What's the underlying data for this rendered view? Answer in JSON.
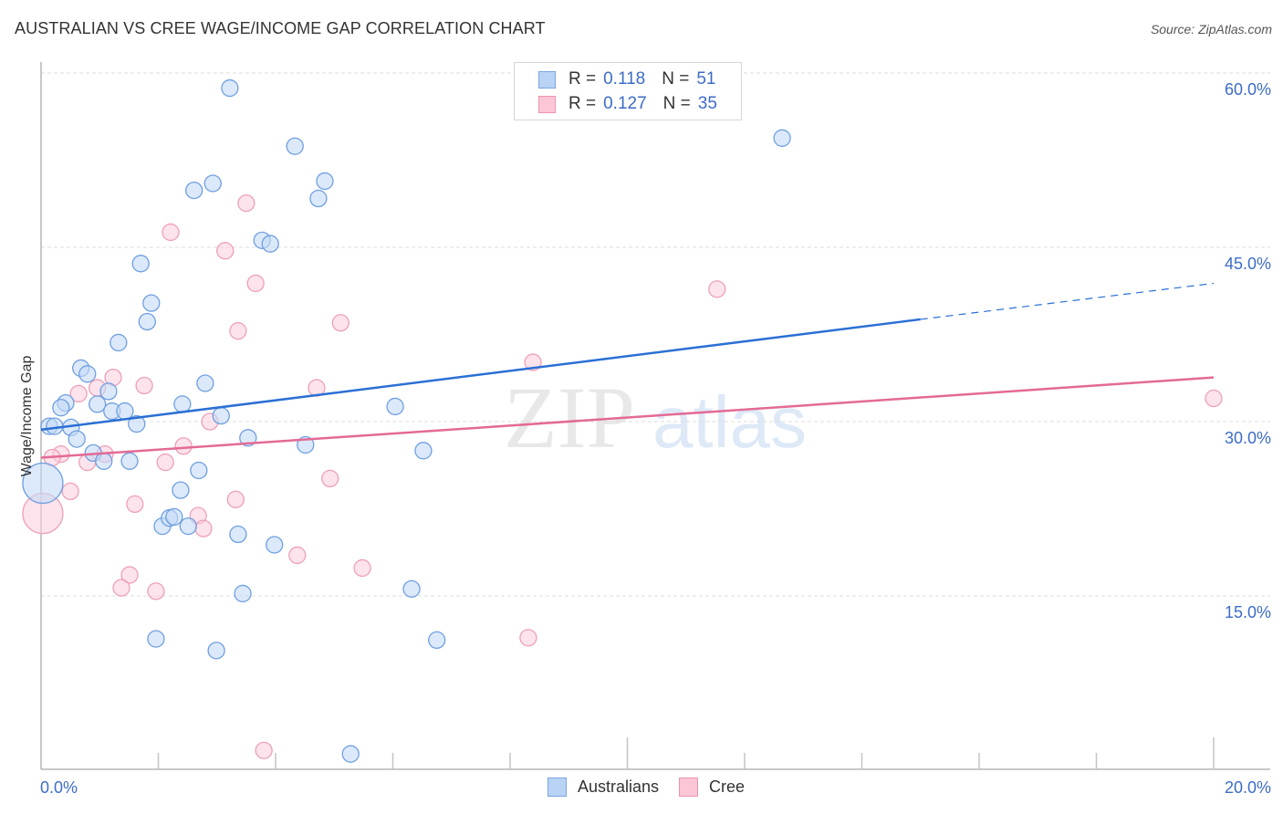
{
  "header": {
    "title": "AUSTRALIAN VS CREE WAGE/INCOME GAP CORRELATION CHART",
    "source": "Source: ZipAtlas.com"
  },
  "legend": {
    "rows": [
      {
        "r_label": "R =",
        "r_value": "0.118",
        "n_label": "N =",
        "n_value": "51",
        "swatch_fill": "#b9d3f5",
        "swatch_border": "#7aa6e0"
      },
      {
        "r_label": "R =",
        "r_value": "0.127",
        "n_label": "N =",
        "n_value": "35",
        "swatch_fill": "#fcc6d6",
        "swatch_border": "#ec94b0"
      }
    ]
  },
  "bottom_legend": [
    {
      "label": "Australians",
      "swatch_fill": "#b9d3f5",
      "swatch_border": "#7aa6e0"
    },
    {
      "label": "Cree",
      "swatch_fill": "#fcc6d6",
      "swatch_border": "#ec94b0"
    }
  ],
  "watermark": {
    "zip": "ZIP",
    "atlas": "atlas"
  },
  "chart_data": {
    "type": "scatter",
    "title": "AUSTRALIAN VS CREE WAGE/INCOME GAP CORRELATION CHART",
    "xlabel": "",
    "ylabel": "Wage/Income Gap",
    "xlim": [
      0,
      20
    ],
    "ylim": [
      0,
      62
    ],
    "x_tick_labels": [
      "0.0%",
      "20.0%"
    ],
    "x_tick_values": [
      0,
      20
    ],
    "x_minor_ticks": [
      2,
      4,
      6,
      8,
      10,
      12,
      14,
      16,
      18,
      20
    ],
    "y_tick_labels": [
      "15.0%",
      "30.0%",
      "45.0%",
      "60.0%"
    ],
    "y_tick_values": [
      15,
      30,
      45,
      60
    ],
    "grid": "horizontal-dashed",
    "legend_position": "top-center",
    "colors": {
      "australians_fill": "#c4daf6",
      "australians_stroke": "#6f9fe0",
      "australians_line": "#2a6fd4",
      "cree_fill": "#fbd0dd",
      "cree_stroke": "#eda0b8",
      "cree_line": "#e36a95",
      "tick_label": "#3d6cc7"
    },
    "series": [
      {
        "name": "Australians",
        "r": 0.118,
        "n": 51,
        "trend": {
          "x0": 0,
          "y0": 29.3,
          "x_solid_end": 15.0,
          "y_solid_end": 38.8,
          "x1": 20,
          "y1": 41.9
        },
        "points": [
          [
            3.22,
            58.7
          ],
          [
            4.33,
            53.7
          ],
          [
            12.64,
            54.4
          ],
          [
            4.84,
            50.7
          ],
          [
            2.93,
            50.5
          ],
          [
            2.61,
            49.9
          ],
          [
            4.73,
            49.2
          ],
          [
            3.77,
            45.6
          ],
          [
            3.91,
            45.3
          ],
          [
            1.7,
            43.6
          ],
          [
            1.88,
            40.2
          ],
          [
            1.81,
            38.6
          ],
          [
            1.32,
            36.8
          ],
          [
            0.68,
            34.6
          ],
          [
            0.79,
            34.1
          ],
          [
            2.8,
            33.3
          ],
          [
            1.15,
            32.6
          ],
          [
            0.42,
            31.6
          ],
          [
            0.34,
            31.2
          ],
          [
            0.96,
            31.5
          ],
          [
            2.41,
            31.5
          ],
          [
            1.21,
            30.9
          ],
          [
            1.43,
            30.9
          ],
          [
            6.04,
            31.3
          ],
          [
            3.07,
            30.5
          ],
          [
            1.63,
            29.8
          ],
          [
            0.14,
            29.6
          ],
          [
            0.23,
            29.6
          ],
          [
            0.51,
            29.5
          ],
          [
            0.61,
            28.5
          ],
          [
            3.53,
            28.6
          ],
          [
            4.51,
            28.0
          ],
          [
            6.52,
            27.5
          ],
          [
            0.89,
            27.3
          ],
          [
            1.07,
            26.6
          ],
          [
            1.51,
            26.6
          ],
          [
            2.69,
            25.8
          ],
          [
            0.03,
            24.7,
            "large"
          ],
          [
            2.38,
            24.1
          ],
          [
            2.07,
            21.0
          ],
          [
            2.19,
            21.7
          ],
          [
            2.27,
            21.8
          ],
          [
            2.51,
            21.0
          ],
          [
            3.36,
            20.3
          ],
          [
            3.98,
            19.4
          ],
          [
            6.32,
            15.6
          ],
          [
            3.44,
            15.2
          ],
          [
            1.96,
            11.3
          ],
          [
            6.75,
            11.2
          ],
          [
            2.99,
            10.3
          ],
          [
            5.28,
            1.4
          ]
        ]
      },
      {
        "name": "Cree",
        "r": 0.127,
        "n": 35,
        "trend": {
          "x0": 0,
          "y0": 26.9,
          "x1": 20,
          "y1": 33.8
        },
        "points": [
          [
            2.21,
            46.3
          ],
          [
            3.5,
            48.8
          ],
          [
            3.14,
            44.7
          ],
          [
            3.66,
            41.9
          ],
          [
            5.11,
            38.5
          ],
          [
            11.53,
            41.4
          ],
          [
            3.36,
            37.8
          ],
          [
            8.39,
            35.1
          ],
          [
            1.23,
            33.8
          ],
          [
            1.76,
            33.1
          ],
          [
            4.7,
            32.9
          ],
          [
            0.64,
            32.4
          ],
          [
            0.96,
            32.9
          ],
          [
            20.0,
            32.0
          ],
          [
            2.88,
            30.0
          ],
          [
            2.43,
            27.9
          ],
          [
            0.34,
            27.2
          ],
          [
            0.19,
            26.9
          ],
          [
            1.09,
            27.2
          ],
          [
            0.79,
            26.5
          ],
          [
            2.12,
            26.5
          ],
          [
            4.93,
            25.1
          ],
          [
            0.5,
            24.0
          ],
          [
            3.32,
            23.3
          ],
          [
            1.6,
            22.9
          ],
          [
            0.03,
            22.1,
            "large"
          ],
          [
            2.68,
            21.9
          ],
          [
            2.77,
            20.8
          ],
          [
            4.37,
            18.5
          ],
          [
            5.48,
            17.4
          ],
          [
            1.51,
            16.8
          ],
          [
            1.37,
            15.7
          ],
          [
            1.96,
            15.4
          ],
          [
            8.31,
            11.4
          ],
          [
            3.8,
            1.7
          ]
        ]
      }
    ]
  }
}
